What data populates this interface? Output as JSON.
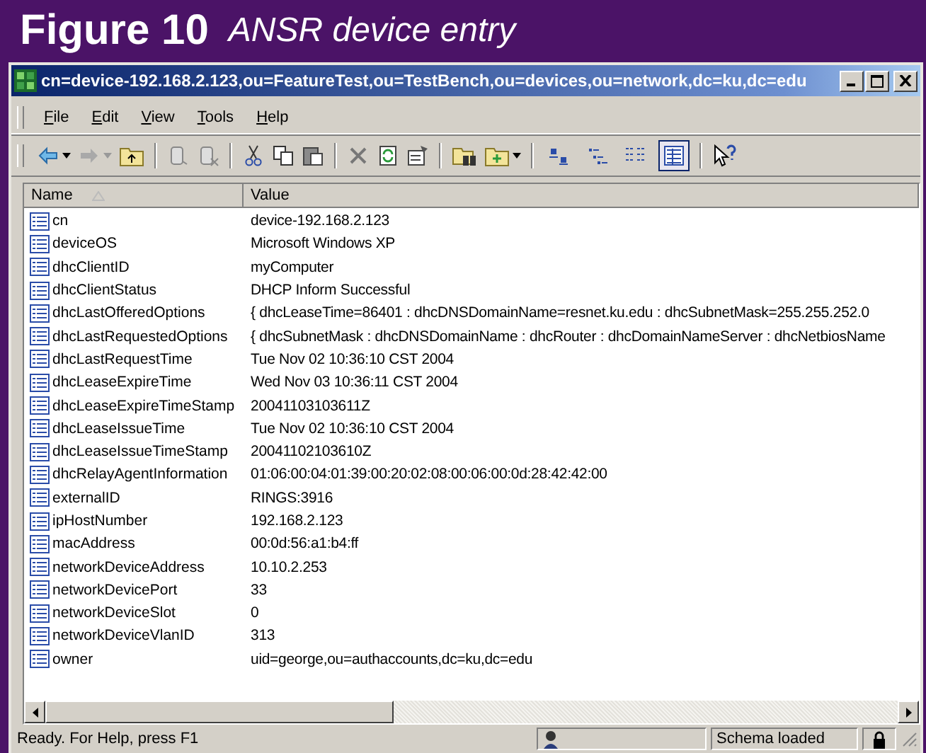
{
  "figure": {
    "number": "Figure 10",
    "caption": "ANSR device entry"
  },
  "window": {
    "title": "cn=device-192.168.2.123,ou=FeatureTest,ou=TestBench,ou=devices,ou=network,dc=ku,dc=edu"
  },
  "menu": [
    "File",
    "Edit",
    "View",
    "Tools",
    "Help"
  ],
  "view_buttons": [
    {
      "selected": false
    },
    {
      "selected": false
    },
    {
      "selected": false
    },
    {
      "selected": true
    }
  ],
  "list": {
    "columns": [
      {
        "label": "Name",
        "sorted": true
      },
      {
        "label": "Value",
        "sorted": false
      }
    ],
    "rows": [
      {
        "name": "cn",
        "value": "device-192.168.2.123"
      },
      {
        "name": "deviceOS",
        "value": "Microsoft Windows XP"
      },
      {
        "name": "dhcClientID",
        "value": "myComputer"
      },
      {
        "name": "dhcClientStatus",
        "value": "DHCP Inform Successful"
      },
      {
        "name": "dhcLastOfferedOptions",
        "value": "{ dhcLeaseTime=86401 : dhcDNSDomainName=resnet.ku.edu : dhcSubnetMask=255.255.252.0"
      },
      {
        "name": "dhcLastRequestedOptions",
        "value": "{ dhcSubnetMask : dhcDNSDomainName : dhcRouter : dhcDomainNameServer : dhcNetbiosName"
      },
      {
        "name": "dhcLastRequestTime",
        "value": "Tue Nov 02 10:36:10 CST 2004"
      },
      {
        "name": "dhcLeaseExpireTime",
        "value": "Wed Nov 03 10:36:11 CST 2004"
      },
      {
        "name": "dhcLeaseExpireTimeStamp",
        "value": "20041103103611Z"
      },
      {
        "name": "dhcLeaseIssueTime",
        "value": "Tue Nov 02 10:36:10 CST 2004"
      },
      {
        "name": "dhcLeaseIssueTimeStamp",
        "value": "20041102103610Z"
      },
      {
        "name": "dhcRelayAgentInformation",
        "value": "01:06:00:04:01:39:00:20:02:08:00:06:00:0d:28:42:42:00"
      },
      {
        "name": "externalID",
        "value": "RINGS:3916"
      },
      {
        "name": "ipHostNumber",
        "value": "192.168.2.123"
      },
      {
        "name": "macAddress",
        "value": "00:0d:56:a1:b4:ff"
      },
      {
        "name": "networkDeviceAddress",
        "value": "10.10.2.253"
      },
      {
        "name": "networkDevicePort",
        "value": "33"
      },
      {
        "name": "networkDeviceSlot",
        "value": "0"
      },
      {
        "name": "networkDeviceVlanID",
        "value": "313"
      },
      {
        "name": "owner",
        "value": "uid=george,ou=authaccounts,dc=ku,dc=edu"
      }
    ]
  },
  "status_bar": {
    "message": "Ready. For Help, press F1",
    "schema": "Schema loaded"
  }
}
